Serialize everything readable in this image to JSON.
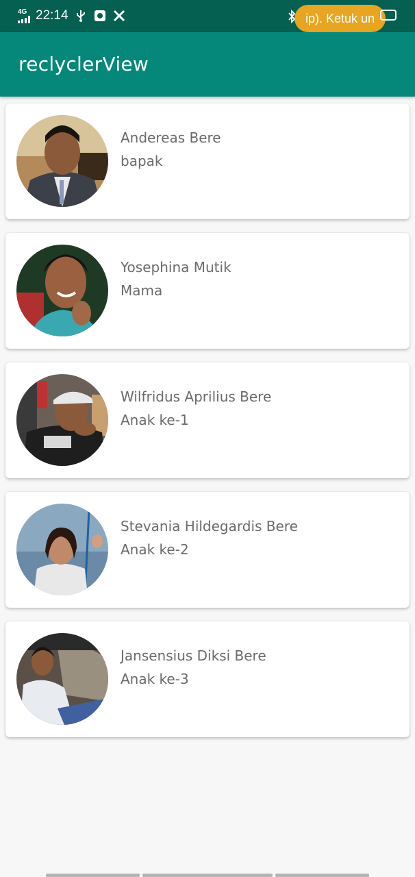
{
  "status_bar": {
    "network": "4G",
    "time": "22:14",
    "notification_pill": "ip). Ketuk un",
    "icons": [
      "usb-icon",
      "notification-app-icon",
      "tools-icon",
      "bluetooth-icon",
      "battery-icon"
    ]
  },
  "app_bar": {
    "title": "reclyclerView",
    "color": "#05887a"
  },
  "contacts": [
    {
      "name": "Andereas Bere",
      "role": "bapak"
    },
    {
      "name": "Yosephina Mutik",
      "role": "Mama"
    },
    {
      "name": "Wilfridus Aprilius Bere",
      "role": "Anak ke-1"
    },
    {
      "name": "Stevania Hildegardis Bere",
      "role": "Anak ke-2"
    },
    {
      "name": "Jansensius Diksi Bere",
      "role": "Anak ke-3"
    }
  ],
  "colors": {
    "status_bar": "#066052",
    "app_bar": "#05887a",
    "pill": "#e8a521",
    "background": "#f7f7f7"
  }
}
